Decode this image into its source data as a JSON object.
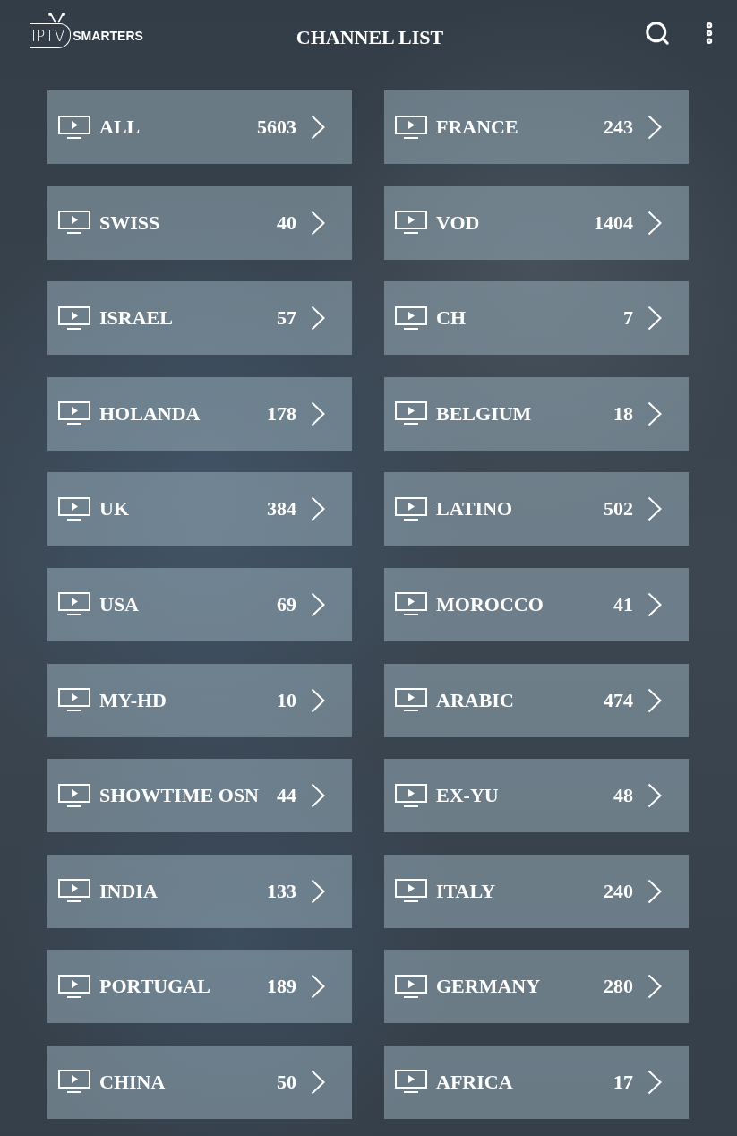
{
  "header": {
    "logo": {
      "text_1": "IPTV",
      "text_2": "SMARTERS"
    },
    "title": "CHANNEL LIST"
  },
  "categories": [
    {
      "name": "ALL",
      "count": "5603"
    },
    {
      "name": "FRANCE",
      "count": "243"
    },
    {
      "name": "SWISS",
      "count": "40"
    },
    {
      "name": "VOD",
      "count": "1404"
    },
    {
      "name": "ISRAEL",
      "count": "57"
    },
    {
      "name": "CH",
      "count": "7"
    },
    {
      "name": "HOLANDA",
      "count": "178"
    },
    {
      "name": "BELGIUM",
      "count": "18"
    },
    {
      "name": "UK",
      "count": "384"
    },
    {
      "name": "LATINO",
      "count": "502"
    },
    {
      "name": "USA",
      "count": "69"
    },
    {
      "name": "MOROCCO",
      "count": "41"
    },
    {
      "name": "MY-HD",
      "count": "10"
    },
    {
      "name": "ARABIC",
      "count": "474"
    },
    {
      "name": "SHOWTIME OSN",
      "count": "44"
    },
    {
      "name": "EX-YU",
      "count": "48"
    },
    {
      "name": "INDIA",
      "count": "133"
    },
    {
      "name": "ITALY",
      "count": "240"
    },
    {
      "name": "PORTUGAL",
      "count": "189"
    },
    {
      "name": "GERMANY",
      "count": "280"
    },
    {
      "name": "CHINA",
      "count": "50"
    },
    {
      "name": "AFRICA",
      "count": "17"
    }
  ]
}
